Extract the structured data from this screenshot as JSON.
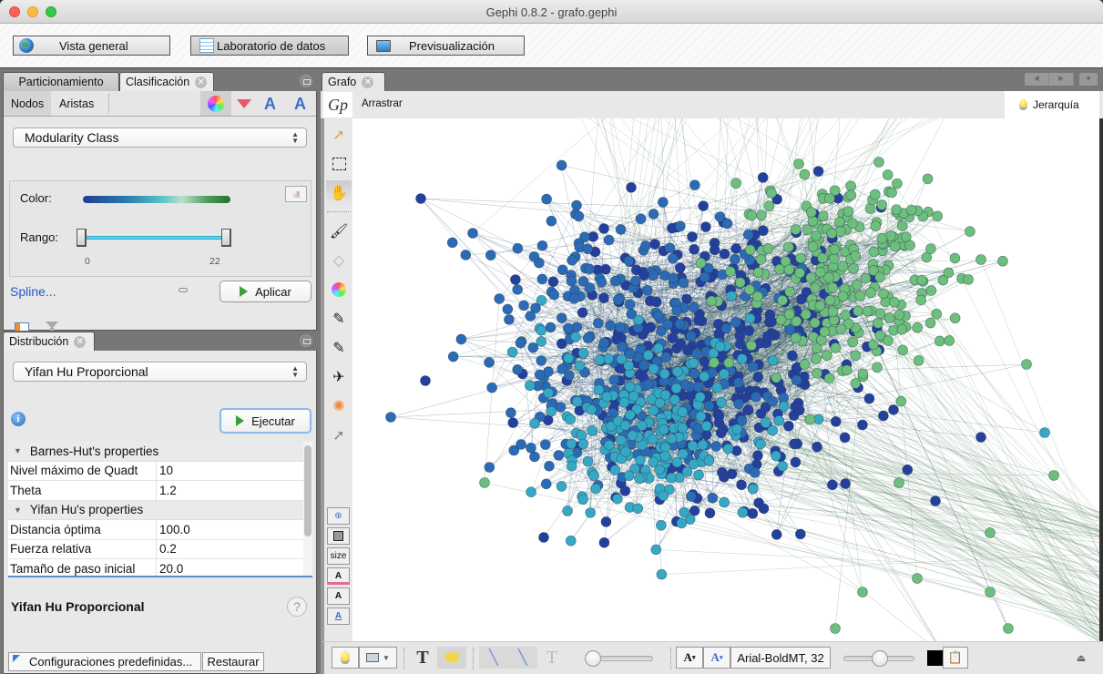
{
  "window": {
    "title": "Gephi 0.8.2 - grafo.gephi"
  },
  "modes": [
    {
      "label": "Vista general",
      "icon": "globe-icon",
      "active": false
    },
    {
      "label": "Laboratorio de datos",
      "icon": "spreadsheet-icon",
      "active": true
    },
    {
      "label": "Previsualización",
      "icon": "monitor-icon",
      "active": false
    }
  ],
  "ranking": {
    "tabs": [
      "Particionamiento",
      "Clasificación"
    ],
    "selected_tab": "Clasificación",
    "subtabs": [
      "Nodos",
      "Aristas"
    ],
    "selected_subtab": "Nodos",
    "tool_icons": [
      "color-wheel-icon",
      "size-diamond-icon",
      "label-color-icon",
      "label-size-icon"
    ],
    "attribute": "Modularity Class",
    "color_label": "Color:",
    "gradient_colors": [
      "#1f3f8f",
      "#2a7ab0",
      "#5fc8c8",
      "#b9e0cc",
      "#4c9b58",
      "#2a6e2a"
    ],
    "range_label": "Rango:",
    "range_min": "0",
    "range_max": "22",
    "spline_link": "Spline...",
    "apply_button": "Aplicar"
  },
  "layout": {
    "tab": "Distribución",
    "algorithm": "Yifan Hu Proporcional",
    "run_button": "Ejecutar",
    "sections": [
      {
        "title": "Barnes-Hut's properties",
        "rows": [
          {
            "key": "Nivel máximo de Quadt",
            "value": "10"
          },
          {
            "key": "Theta",
            "value": "1.2"
          }
        ]
      },
      {
        "title": "Yifan Hu's properties",
        "rows": [
          {
            "key": "Distancia óptima",
            "value": "100.0"
          },
          {
            "key": "Fuerza relativa",
            "value": "0.2"
          },
          {
            "key": "Tamaño de paso inicial",
            "value": "20.0"
          }
        ]
      }
    ],
    "description_title": "Yifan Hu Proporcional",
    "presets_button": "Configuraciones predefinidas...",
    "restore_button": "Restaurar"
  },
  "graph": {
    "tab": "Grafo",
    "logo": "Gp",
    "mode_label": "Arrastrar",
    "hierarchy_label": "Jerarquía",
    "tools": [
      "pointer-icon",
      "rectangle-select-icon",
      "hand-drag-icon",
      "brush-icon",
      "diamond-size-icon",
      "color-palette-icon",
      "pencil-icon",
      "pencil-edge-icon",
      "airplane-icon",
      "heatmap-icon",
      "pointer-help-icon"
    ],
    "bottom_tools": [
      "zoom-fit-icon",
      "background-color-icon",
      "size-label",
      "label-color-icon",
      "label-font-icon",
      "label-size-icon"
    ],
    "size_label": "size",
    "font_label": "Arial-BoldMT, 32",
    "community_colors": {
      "dark_blue": "#23409e",
      "blue": "#2b6bb5",
      "cyan": "#35a8c6",
      "green": "#6cbf7c"
    }
  }
}
